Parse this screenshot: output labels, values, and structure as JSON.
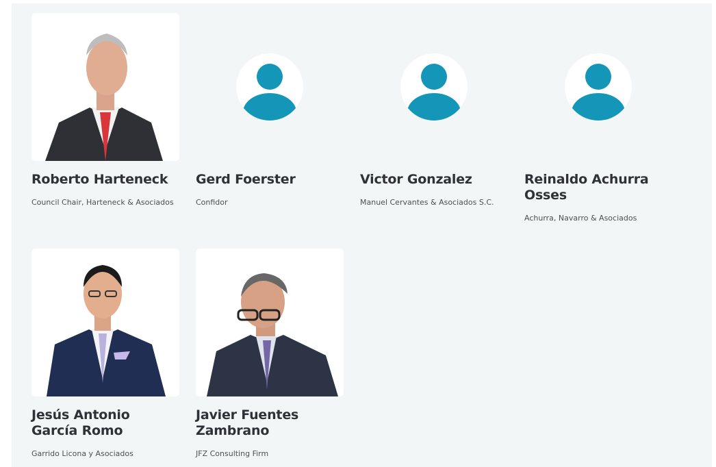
{
  "members": [
    {
      "name": "Roberto Harteneck",
      "org": "Council Chair, Harteneck & Asociados",
      "photo": "portrait-photo"
    },
    {
      "name": "Gerd Foerster",
      "org": "Confidor",
      "photo": "avatar-placeholder-icon"
    },
    {
      "name": "Victor Gonzalez",
      "org": "Manuel Cervantes & Asociados S.C.",
      "photo": "avatar-placeholder-icon"
    },
    {
      "name": "Reinaldo Achurra Osses",
      "org": "Achurra, Navarro & Asociados",
      "photo": "avatar-placeholder-icon"
    },
    {
      "name": "Jesús Antonio García Romo",
      "org": "Garrido Licona y Asociados",
      "photo": "portrait-photo"
    },
    {
      "name": "Javier Fuentes Zambrano",
      "org": "JFZ Consulting Firm",
      "photo": "portrait-photo"
    }
  ],
  "colors": {
    "background": "#f3f6f6",
    "avatar_accent": "#1496b8",
    "name_text": "#2f3136",
    "org_text": "#4b4f55"
  }
}
